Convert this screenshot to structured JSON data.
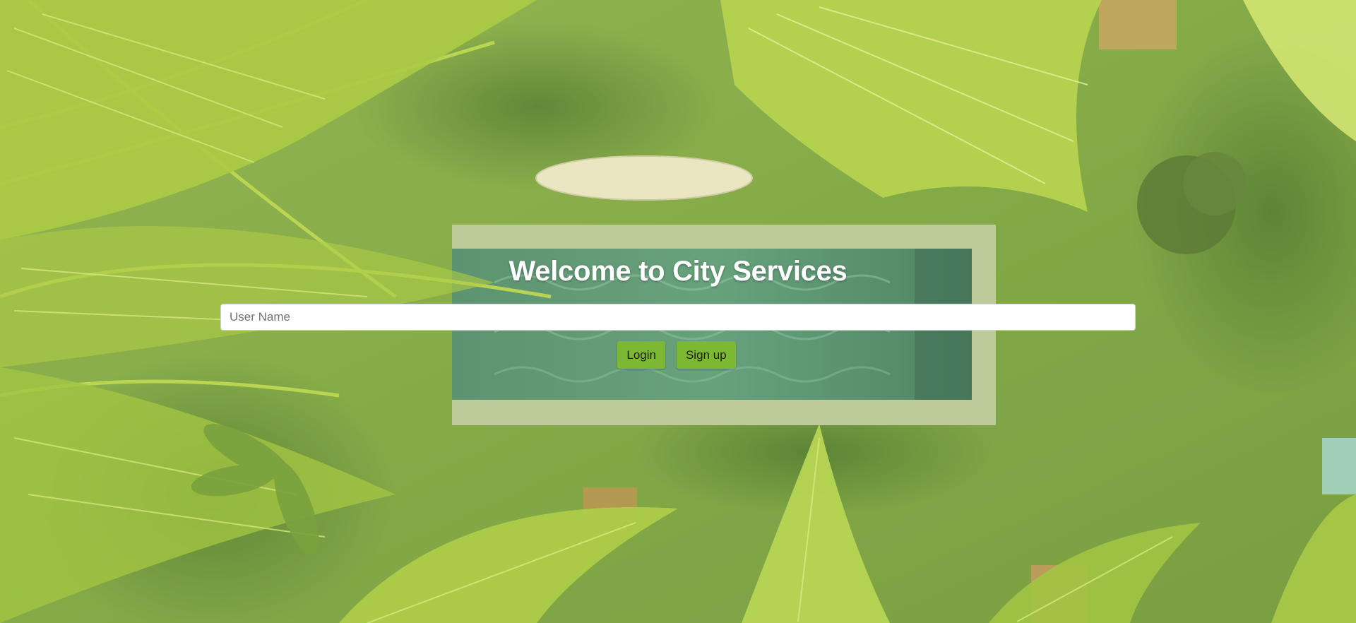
{
  "page": {
    "title": "Welcome to City Services"
  },
  "login_form": {
    "username_placeholder": "User Name",
    "username_value": "",
    "login_label": "Login",
    "signup_label": "Sign up"
  },
  "colors": {
    "button_bg": "#7cb832",
    "title_text": "#ffffff",
    "grass": "#7fa443"
  },
  "background": {
    "description_icon": "tropical-pool-aerial-photo"
  }
}
